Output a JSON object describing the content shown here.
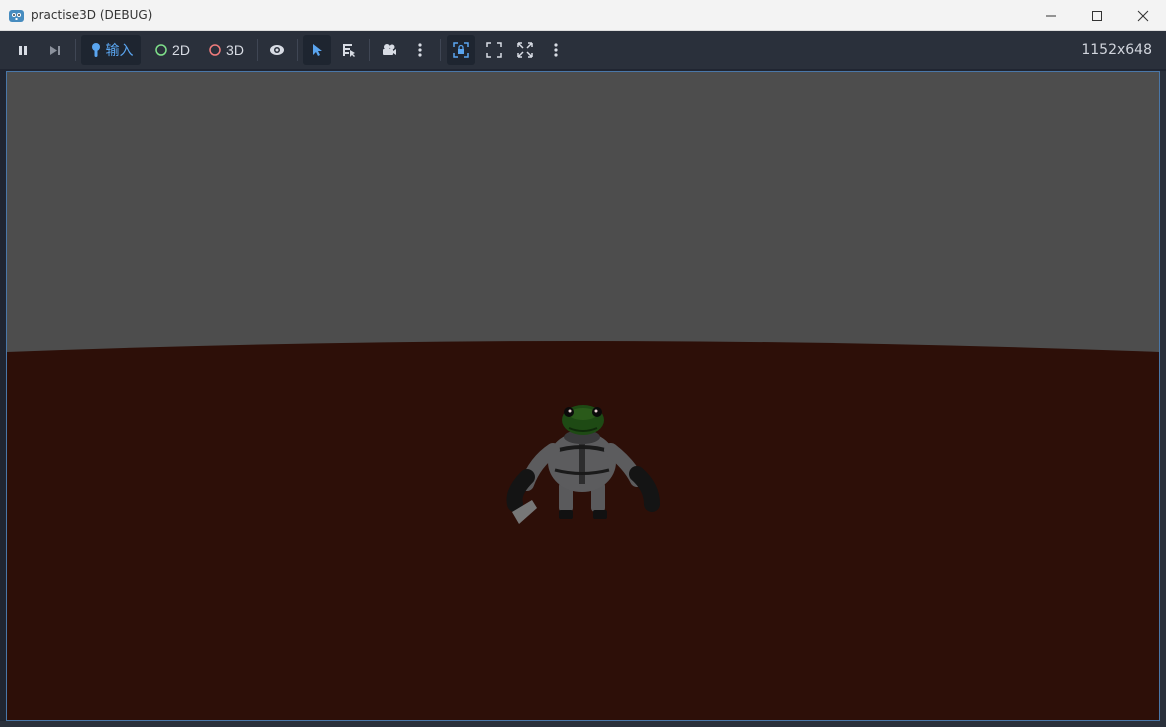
{
  "window": {
    "title": "practise3D (DEBUG)",
    "icon": "godot-icon"
  },
  "toolbar": {
    "pause_icon": "pause-icon",
    "next_frame_icon": "next-frame-icon",
    "input_label": "输入",
    "mode_2d_label": "2D",
    "mode_3d_label": "3D",
    "resolution": "1152x648"
  },
  "colors": {
    "sky": "#4d4d4d",
    "ground": "#2d0f08",
    "accent": "#5aa5f0",
    "mode_2d_dot": "#7fe08a",
    "mode_3d_dot": "#f07c7c"
  }
}
